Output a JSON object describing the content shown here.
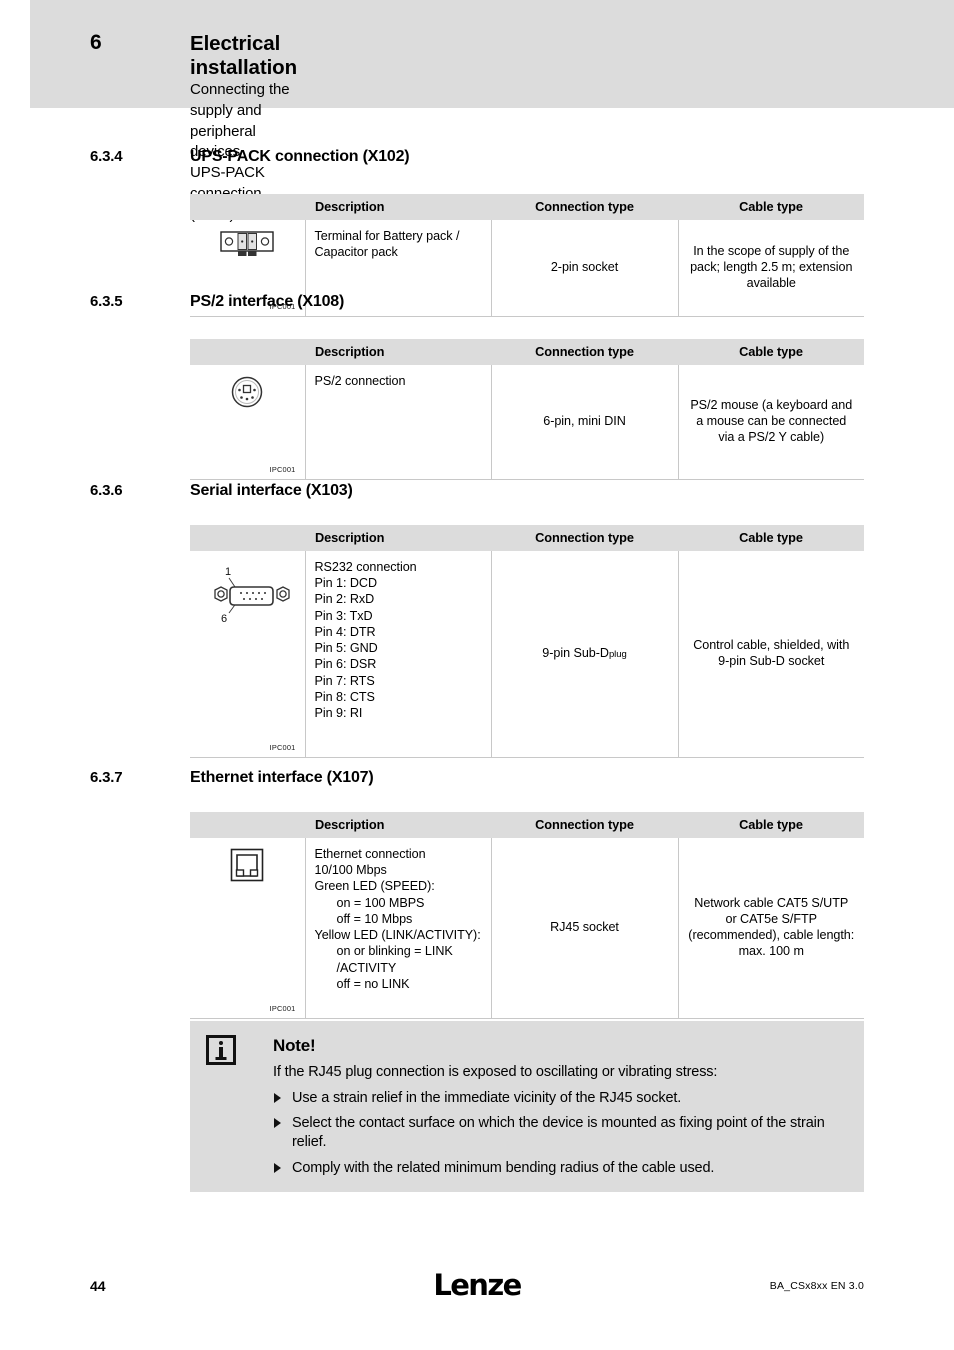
{
  "header": {
    "chapter_number": "6",
    "title": "Electrical installation",
    "subtitle1": "Connecting the supply and peripheral devices",
    "subtitle2": "UPS-PACK connection (X102)"
  },
  "table_headers": {
    "icon": "",
    "description": "Description",
    "connection_type": "Connection type",
    "cable_type": "Cable type"
  },
  "sections": [
    {
      "number": "6.3.4",
      "title": "UPS-PACK connection (X102)",
      "icon_name": "terminal-2pin-icon",
      "icon_caption": "IPC001",
      "description_lines": [
        "Terminal for Battery pack /",
        "Capacitor pack"
      ],
      "connection_type": "2-pin socket",
      "cable_type": "In the scope of supply of the pack; length 2.5 m; extension available"
    },
    {
      "number": "6.3.5",
      "title": "PS/2 interface (X108)",
      "icon_name": "mini-din-connector-icon",
      "icon_caption": "IPC001",
      "description_lines": [
        "PS/2 connection"
      ],
      "connection_type": "6-pin, mini DIN",
      "cable_type": "PS/2 mouse (a keyboard and a mouse can be connected via a PS/2 Y cable)"
    },
    {
      "number": "6.3.6",
      "title": "Serial interface (X103)",
      "icon_name": "sub-d-connector-icon",
      "icon_caption": "IPC001",
      "icon_pin_labels": {
        "top": "1",
        "bottom": "6"
      },
      "description_lines": [
        "RS232 connection",
        "Pin 1: DCD",
        "Pin 2: RxD",
        "Pin 3: TxD",
        "Pin 4: DTR",
        "Pin 5: GND",
        "Pin 6: DSR",
        "Pin 7: RTS",
        "Pin 8: CTS",
        "Pin 9: RI"
      ],
      "connection_type": "9-pin Sub-D",
      "connection_type_suffix": "plug",
      "cable_type": "Control cable, shielded, with 9-pin Sub-D socket"
    },
    {
      "number": "6.3.7",
      "title": "Ethernet interface (X107)",
      "icon_name": "rj45-socket-icon",
      "icon_caption": "IPC001",
      "description_lines": [
        "Ethernet connection",
        "10/100 Mbps",
        "Green LED (SPEED):",
        "on = 100 MBPS",
        "off = 10 Mbps",
        "Yellow LED (LINK/ACTIVITY):",
        "on or blinking = LINK",
        "/ACTIVITY",
        "off = no LINK"
      ],
      "connection_type": "RJ45 socket",
      "cable_type": "Network cable CAT5 S/UTP or CAT5e S/FTP (recommended), cable length: max. 100 m"
    }
  ],
  "note": {
    "icon_name": "info-icon",
    "title": "Note!",
    "intro": "If the RJ45 plug connection is exposed to oscillating or vibrating stress:",
    "items": [
      "Use a strain relief in the immediate vicinity of the RJ45 socket.",
      "Select the contact surface on which the device is mounted as fixing point of the strain relief.",
      "Comply with the related minimum bending radius of the cable used."
    ]
  },
  "footer": {
    "page_number": "44",
    "logo_text": "Lenze",
    "document_id": "BA_CSx8xx EN 3.0"
  },
  "colors": {
    "band_gray": "#dcdcdc",
    "border_gray": "#c8c8c8",
    "text": "#000000"
  }
}
